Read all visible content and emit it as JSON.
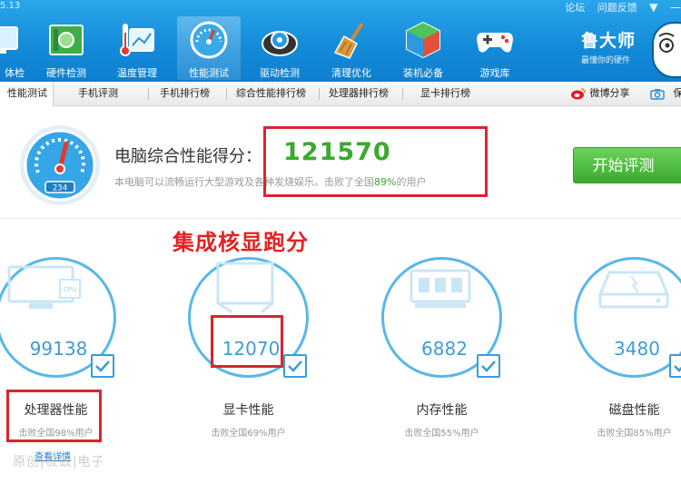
{
  "app": {
    "version": "5.13",
    "window_links": [
      "论坛",
      "问题反馈"
    ],
    "window_controls": [
      "▼",
      "—"
    ]
  },
  "nav": {
    "items": [
      {
        "label": "体检",
        "icon": "monitor-icon"
      },
      {
        "label": "硬件检测",
        "icon": "circuit-board-icon"
      },
      {
        "label": "温度管理",
        "icon": "thermometer-chart-icon"
      },
      {
        "label": "性能测试",
        "icon": "speedometer-icon"
      },
      {
        "label": "驱动检测",
        "icon": "gear-disc-icon"
      },
      {
        "label": "清理优化",
        "icon": "broom-icon"
      },
      {
        "label": "装机必备",
        "icon": "cube-box-icon"
      },
      {
        "label": "游戏库",
        "icon": "gamepad-icon"
      }
    ],
    "active_index": 3
  },
  "brand": {
    "name": "鲁大师",
    "slogan": "最懂你的硬件"
  },
  "tabs": {
    "items": [
      "性能测试",
      "手机评测",
      "手机排行榜",
      "综合性能排行榜",
      "处理器排行榜",
      "显卡排行榜"
    ],
    "active_index": 0,
    "share_label": "微博分享",
    "save_label": "保"
  },
  "score": {
    "title": "电脑综合性能得分：",
    "value": "121570",
    "description_prefix": "本电脑可以流畅运行大型游戏及各种发烧娱乐。击败了全国",
    "beat_percent": "89%",
    "description_suffix": "的用户",
    "gauge_reading": "234",
    "start_button": "开始评测"
  },
  "annotation": "集成核显跑分",
  "cards": [
    {
      "name": "处理器性能",
      "value": "99138",
      "beat": "击败全国98%用户",
      "icon": "monitor-cpu-icon"
    },
    {
      "name": "显卡性能",
      "value": "12070",
      "beat": "击败全国69%用户",
      "icon": "gpu-cube-icon"
    },
    {
      "name": "内存性能",
      "value": "6882",
      "beat": "击败全国55%用户",
      "icon": "memory-chip-icon"
    },
    {
      "name": "磁盘性能",
      "value": "3480",
      "beat": "击败全国85%用户",
      "icon": "hard-disk-icon"
    }
  ],
  "detail_link": "查看详情",
  "watermark": "原创|极致|电子",
  "colors": {
    "accent_blue": "#1a8fdc",
    "score_green": "#3aaa2e",
    "highlight_red": "#d8262c",
    "card_blue": "#3a9ed6"
  }
}
